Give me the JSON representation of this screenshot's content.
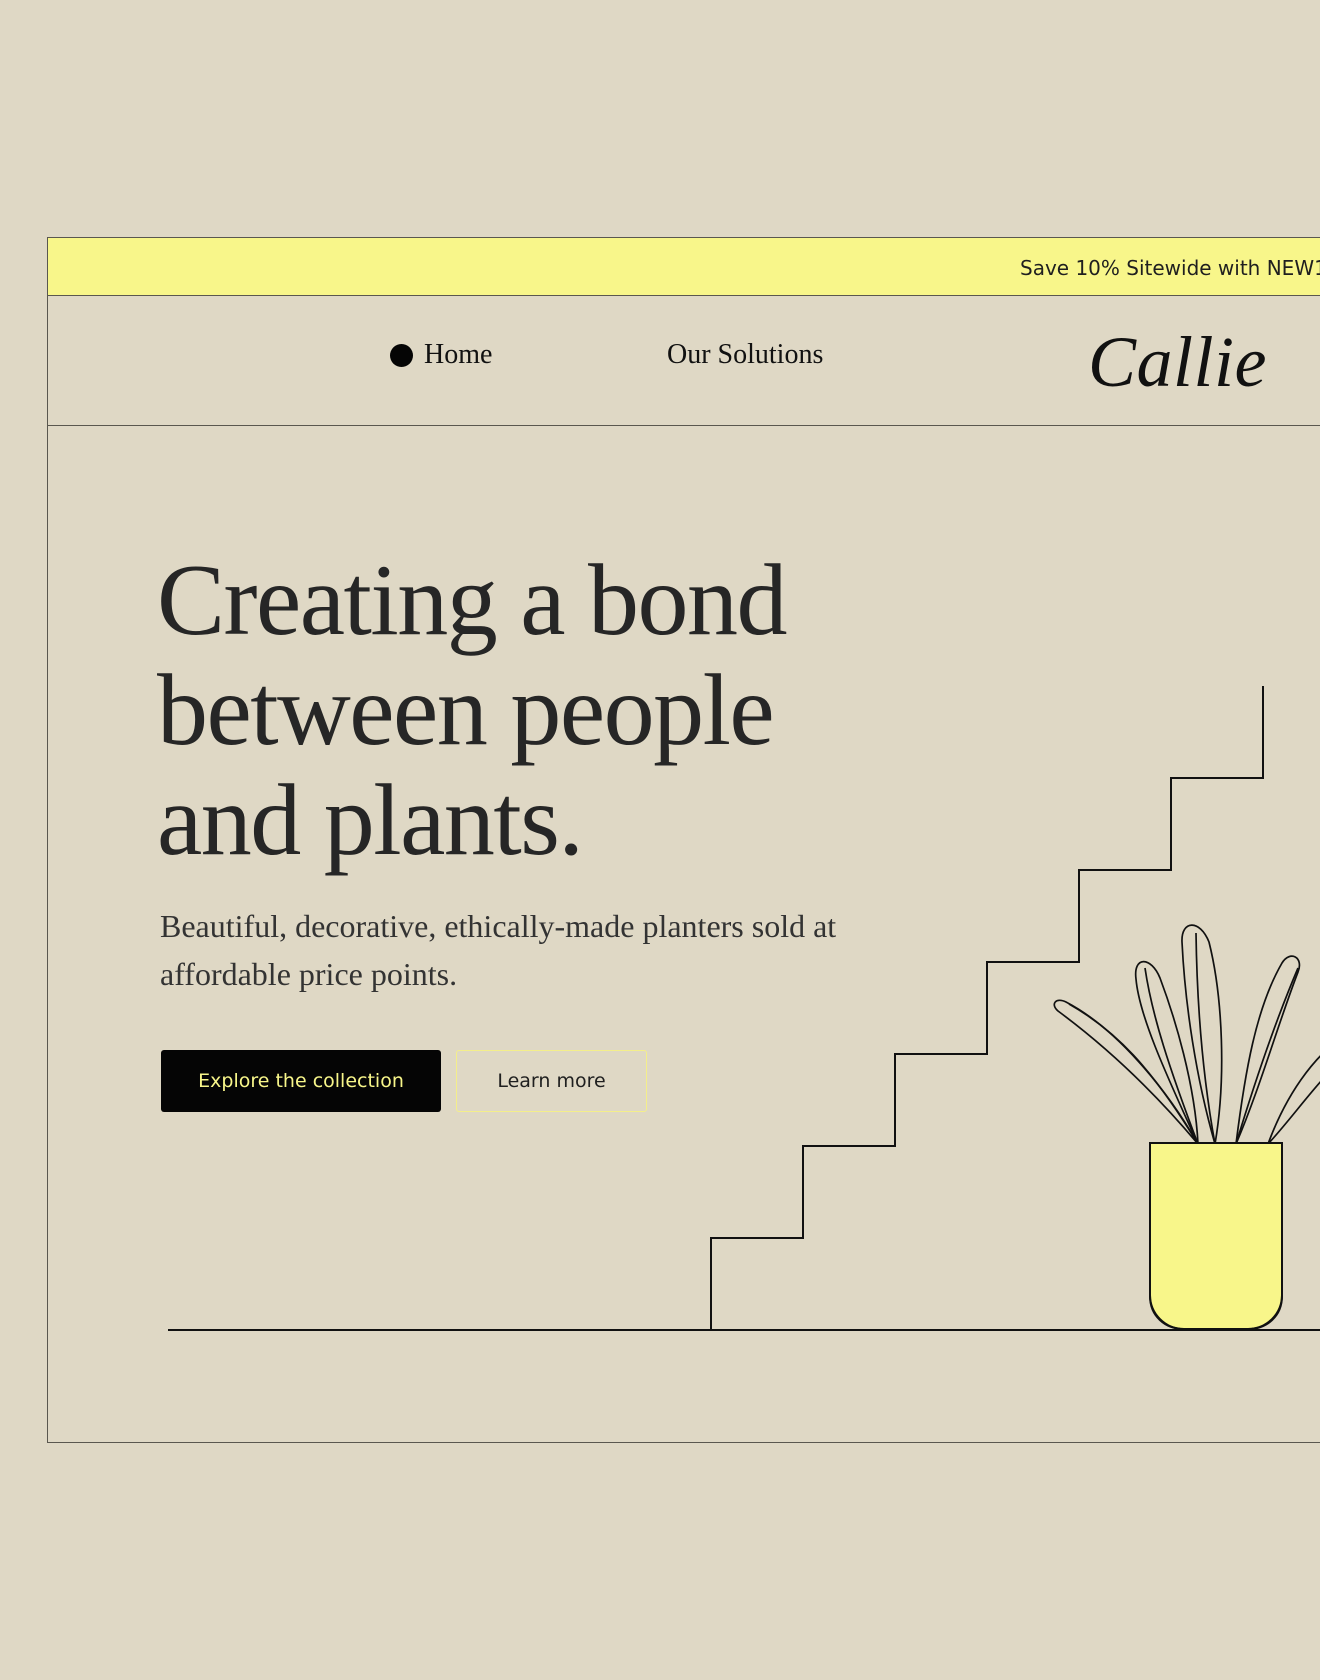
{
  "promo": {
    "text": "Save 10% Sitewide with NEW1"
  },
  "nav": {
    "home": "Home",
    "solutions": "Our Solutions",
    "logo": "Callie"
  },
  "hero": {
    "title": "Creating a bond\nbetween people\nand plants.",
    "subtitle": "Beautiful, decorative, ethically-made planters sold at affordable price points.",
    "primary_cta": "Explore the collection",
    "secondary_cta": "Learn more"
  },
  "colors": {
    "page_background": "#dfd8c5",
    "accent_yellow": "#f8f68a",
    "dark": "#050505"
  },
  "icons": {
    "home_marker": "solid-dot",
    "illustration": "stairs-and-potted-plant"
  }
}
